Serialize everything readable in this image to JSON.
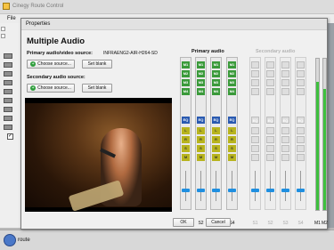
{
  "app": {
    "title": "Cinegy Route Control",
    "menu_file": "File"
  },
  "status": {
    "label": "route"
  },
  "dialog": {
    "title": "Properties",
    "heading": "Multiple Audio",
    "primary_label": "Primary audio/video source:",
    "primary_value": "INFRAENG2-AIR-H264-SD",
    "secondary_label": "Secondary audio source:",
    "choose_source": "Choose source...",
    "set_blank": "Set blank",
    "ok": "OK",
    "cancel": "Cancel"
  },
  "mixer": {
    "primary_heading": "Primary audio",
    "secondary_heading": "Secondary audio",
    "primary_strips": [
      {
        "label": "S1",
        "cells": [
          "M1",
          "M2",
          "M3",
          "M4"
        ]
      },
      {
        "label": "S2",
        "cells": [
          "M1",
          "M2",
          "M3",
          "M4"
        ]
      },
      {
        "label": "S3",
        "cells": [
          "M1",
          "M2",
          "M3",
          "M4"
        ]
      },
      {
        "label": "S4",
        "cells": [
          "M1",
          "M2",
          "M3",
          "M4"
        ]
      }
    ],
    "secondary_strips": [
      "S1",
      "S2",
      "S3",
      "S4"
    ],
    "eq_label": "EQ",
    "letters": [
      "L",
      "R",
      "S",
      "M"
    ],
    "meter_labels": [
      "M1",
      "M2"
    ],
    "fader_levels": [
      0.35,
      0.35,
      0.35,
      0.35,
      0.35,
      0.35,
      0.35,
      0.35
    ],
    "meter_levels": [
      0.85,
      0.8
    ]
  },
  "colors": {
    "mute_green": "#3a9a3a",
    "eq_blue": "#2a5ab0",
    "fader_blue": "#1f8fe0"
  }
}
